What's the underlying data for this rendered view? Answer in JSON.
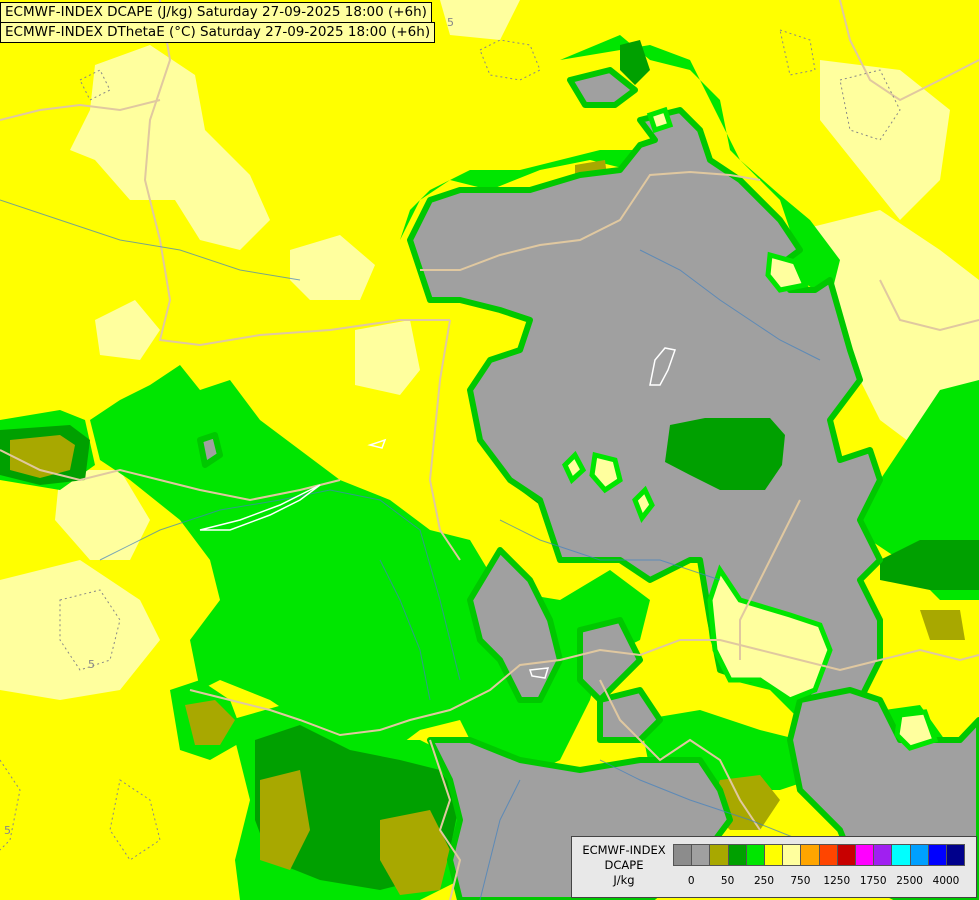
{
  "titles": {
    "line1": "ECMWF-INDEX DCAPE (J/kg) Saturday 27-09-2025 18:00 (+6h)",
    "line2": "ECMWF-INDEX DThetaE (°C) Saturday 27-09-2025 18:00 (+6h)"
  },
  "legend": {
    "title_line1": "ECMWF-INDEX",
    "title_line2": "DCAPE",
    "units": "J/kg",
    "colors": [
      "#8c8c8c",
      "#a0a0a0",
      "#a8a800",
      "#00a000",
      "#00e600",
      "#ffff00",
      "#ffff9e",
      "#ffa500",
      "#ff4500",
      "#c80000",
      "#ff00ff",
      "#a020f0",
      "#00ffff",
      "#00a0ff",
      "#0000ff",
      "#00008b"
    ],
    "ticks": [
      "0",
      "50",
      "250",
      "750",
      "1250",
      "1750",
      "2500",
      "4000"
    ]
  },
  "map_labels": {
    "contour_a": "5",
    "contour_b": "5",
    "contour_c": "5"
  }
}
